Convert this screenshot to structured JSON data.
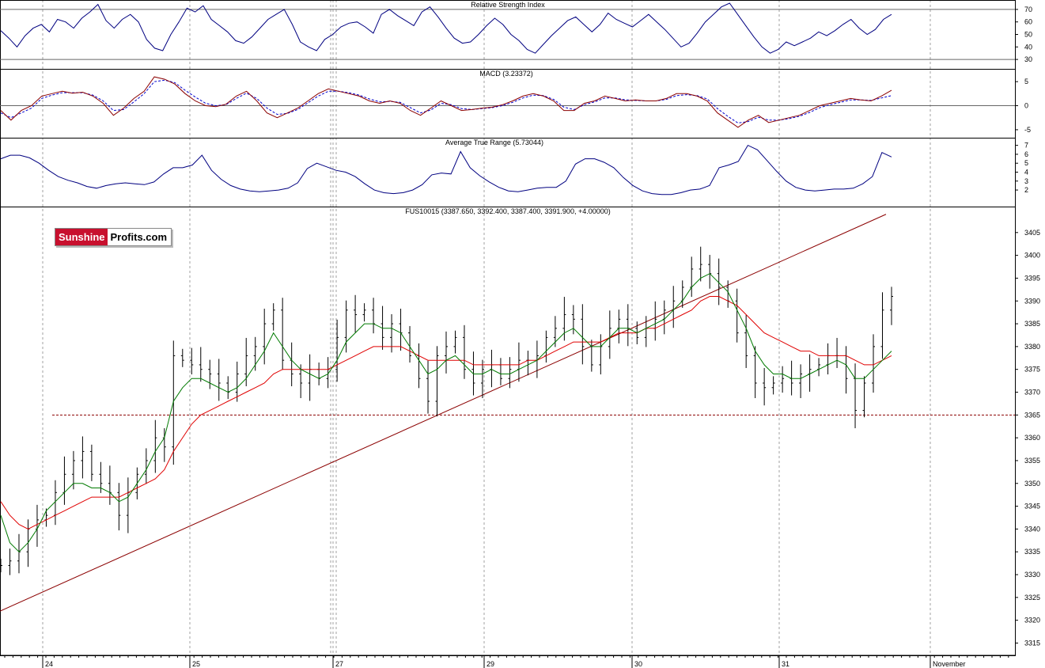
{
  "brand": {
    "part1": "Sunshine",
    "part2": "Profits.com"
  },
  "colors": {
    "rsi": "#000080",
    "macd": "#8b0000",
    "macd_signal": "#0000cd",
    "atr": "#000080",
    "bars": "#000000",
    "ma_fast": "#007a00",
    "ma_slow": "#e00000",
    "trendline": "#8b0000",
    "support": "#8b0000",
    "grid": "#a0a0a0"
  },
  "chart_data": [
    {
      "type": "line",
      "title": "Relative Strength Index",
      "ylim": [
        25,
        75
      ],
      "yticks": [
        30,
        40,
        50,
        60,
        70
      ],
      "reference_levels": [
        30,
        70
      ],
      "series": [
        {
          "values": [
            53,
            47,
            40,
            49,
            55,
            58,
            52,
            62,
            60,
            55,
            63,
            68,
            74,
            61,
            55,
            62,
            66,
            60,
            46,
            39,
            37,
            50,
            60,
            71,
            68,
            73,
            62,
            57,
            52,
            45,
            43,
            48,
            55,
            62,
            66,
            70,
            58,
            44,
            40,
            37,
            46,
            50,
            56,
            59,
            60,
            56,
            51,
            66,
            70,
            65,
            61,
            57,
            68,
            72,
            64,
            55,
            47,
            43,
            44,
            50,
            57,
            63,
            58,
            50,
            45,
            38,
            35,
            42,
            49,
            55,
            61,
            64,
            58,
            52,
            58,
            67,
            62,
            59,
            56,
            61,
            66,
            60,
            54,
            47,
            40,
            43,
            51,
            60,
            66,
            72,
            75,
            66,
            57,
            48,
            40,
            35,
            38,
            44,
            41,
            44,
            47,
            52,
            49,
            53,
            58,
            62,
            55,
            50,
            54,
            62,
            66
          ]
        }
      ]
    },
    {
      "type": "line",
      "title": "MACD (3.23372)",
      "ylim": [
        -6,
        7
      ],
      "yticks": [
        5,
        0,
        -5
      ],
      "series": [
        {
          "values": [
            -1,
            -3,
            -1,
            0,
            2,
            2.5,
            3,
            2.6,
            2.8,
            2,
            0.5,
            -2,
            -0.5,
            1.5,
            3,
            6,
            5.5,
            4.5,
            2.5,
            1,
            0,
            -0.2,
            0.3,
            2,
            3,
            1,
            -1.5,
            -2.5,
            -1.5,
            -0.5,
            1,
            2.5,
            3.5,
            3,
            2.5,
            2,
            1,
            0.5,
            1,
            0.5,
            -1,
            -2,
            -0.5,
            1,
            0,
            -1,
            -0.8,
            -0.5,
            -0.3,
            0.2,
            1,
            2,
            2.5,
            2,
            1,
            -1,
            -1,
            0.5,
            1,
            2,
            1.5,
            1,
            1.2,
            1,
            1,
            1.5,
            2.5,
            2.5,
            2,
            1,
            -1.5,
            -3,
            -4.5,
            -3,
            -2,
            -3.5,
            -3,
            -2.5,
            -2,
            -1,
            0,
            0.5,
            1,
            1.5,
            1.2,
            1,
            2,
            3.2
          ]
        },
        {
          "values": [
            -1.5,
            -2.5,
            -1.5,
            -0.5,
            1.5,
            2.2,
            2.7,
            2.7,
            2.7,
            2.2,
            1,
            -1,
            -0.8,
            0.8,
            2.5,
            5,
            5.3,
            4.8,
            3.2,
            1.8,
            0.5,
            0,
            0.2,
            1.5,
            2.6,
            1.5,
            -0.5,
            -1.8,
            -1.6,
            -0.8,
            0.6,
            2,
            3,
            3,
            2.7,
            2.2,
            1.4,
            0.8,
            0.9,
            0.7,
            -0.4,
            -1.5,
            -0.9,
            0.5,
            0.2,
            -0.6,
            -0.8,
            -0.6,
            -0.4,
            0,
            0.7,
            1.6,
            2.2,
            2.1,
            1.3,
            -0.3,
            -0.8,
            0.2,
            0.8,
            1.6,
            1.6,
            1.2,
            1.1,
            1,
            1,
            1.3,
            2.1,
            2.3,
            2.1,
            1.4,
            -0.6,
            -2.2,
            -3.6,
            -3.3,
            -2.4,
            -3,
            -3,
            -2.7,
            -2.2,
            -1.4,
            -0.4,
            0.2,
            0.7,
            1.2,
            1.2,
            1.1,
            1.6,
            2.1
          ]
        }
      ]
    },
    {
      "type": "line",
      "title": "Average True Range (5.73044)",
      "ylim": [
        0.5,
        7.5
      ],
      "yticks": [
        2,
        3,
        4,
        5,
        6,
        7
      ],
      "series": [
        {
          "values": [
            5.5,
            5.9,
            5.9,
            5.6,
            5,
            4.2,
            3.5,
            3.1,
            2.8,
            2.4,
            2.2,
            2.5,
            2.7,
            2.8,
            2.7,
            2.6,
            2.9,
            3.8,
            4.5,
            4.5,
            4.8,
            5.9,
            4.2,
            3.2,
            2.5,
            2.1,
            1.9,
            1.8,
            1.9,
            2,
            2.2,
            2.8,
            4.4,
            5,
            4.6,
            4.2,
            4,
            3.5,
            2.7,
            2,
            1.7,
            1.6,
            1.7,
            2,
            2.6,
            3.7,
            3.9,
            3.8,
            6.3,
            4.5,
            3.6,
            2.9,
            2.3,
            1.9,
            1.8,
            2,
            2.2,
            2.3,
            2.3,
            3,
            4.9,
            5.5,
            5.5,
            5.1,
            4.5,
            3.4,
            2.5,
            1.9,
            1.6,
            1.5,
            1.5,
            1.7,
            2,
            2.1,
            2.5,
            4.5,
            4.8,
            5.2,
            7,
            6.5,
            5.3,
            4.1,
            3,
            2.3,
            2,
            1.9,
            2,
            2.1,
            2.1,
            2.2,
            2.7,
            3.5,
            6.2,
            5.7
          ]
        }
      ]
    },
    {
      "type": "line",
      "title": "FUS10015 (3387.650, 3392.400, 3387.400, 3391.900, +4.00000)",
      "ylim": [
        3313,
        3410
      ],
      "yticks": [
        3315,
        3320,
        3325,
        3330,
        3335,
        3340,
        3345,
        3350,
        3355,
        3360,
        3365,
        3370,
        3375,
        3380,
        3385,
        3390,
        3395,
        3400,
        3405
      ],
      "x_tick_labels": [
        "24",
        "25",
        "27",
        "29",
        "30",
        "31",
        "November"
      ],
      "series": [
        {
          "values": [
            3332,
            3333,
            3335,
            3340,
            3342,
            3343,
            3348,
            3352,
            3355,
            3357,
            3352,
            3350,
            3348,
            3343,
            3348,
            3352,
            3355,
            3360,
            3358,
            3378,
            3377,
            3376,
            3375,
            3374,
            3372,
            3370,
            3374,
            3378,
            3380,
            3385,
            3388,
            3377,
            3374,
            3372,
            3375,
            3373,
            3375,
            3382,
            3388,
            3387,
            3388,
            3385,
            3382,
            3385,
            3383,
            3378,
            3373,
            3368,
            3378,
            3380,
            3382,
            3375,
            3372,
            3375,
            3376,
            3373,
            3375,
            3377,
            3377,
            3378,
            3382,
            3384,
            3387,
            3386,
            3380,
            3376,
            3380,
            3384,
            3386,
            3384,
            3382,
            3384,
            3386,
            3388,
            3390,
            3393,
            3397,
            3398,
            3396,
            3393,
            3390,
            3383,
            3378,
            3372,
            3371,
            3372,
            3373,
            3372,
            3374,
            3375,
            3376,
            3378,
            3378,
            3373,
            3366,
            3372,
            3380,
            3388,
            3391
          ]
        },
        {
          "values": [
            3343,
            3337,
            3335,
            3337,
            3340,
            3344,
            3346,
            3348,
            3350,
            3350,
            3349,
            3349,
            3348,
            3346,
            3347,
            3350,
            3353,
            3357,
            3360,
            3368,
            3371,
            3373,
            3373,
            3372,
            3371,
            3370,
            3371,
            3373,
            3376,
            3379,
            3383,
            3380,
            3377,
            3375,
            3374,
            3373,
            3374,
            3377,
            3381,
            3383,
            3385,
            3385,
            3384,
            3384,
            3383,
            3380,
            3377,
            3374,
            3375,
            3377,
            3378,
            3376,
            3374,
            3374,
            3375,
            3374,
            3374,
            3375,
            3376,
            3377,
            3379,
            3381,
            3383,
            3384,
            3382,
            3380,
            3380,
            3382,
            3384,
            3384,
            3383,
            3384,
            3385,
            3386,
            3388,
            3390,
            3393,
            3395,
            3396,
            3394,
            3392,
            3388,
            3384,
            3379,
            3376,
            3374,
            3374,
            3373,
            3373,
            3374,
            3375,
            3376,
            3377,
            3376,
            3373,
            3373,
            3375,
            3377,
            3379
          ]
        },
        {
          "values": [
            3346,
            3343,
            3341,
            3340,
            3341,
            3342,
            3343,
            3344,
            3345,
            3346,
            3347,
            3347,
            3347,
            3347,
            3348,
            3349,
            3350,
            3351,
            3353,
            3357,
            3360,
            3363,
            3365,
            3366,
            3367,
            3368,
            3369,
            3370,
            3371,
            3372,
            3374,
            3375,
            3375,
            3375,
            3375,
            3375,
            3375,
            3376,
            3377,
            3378,
            3379,
            3380,
            3380,
            3380,
            3380,
            3379,
            3378,
            3377,
            3377,
            3377,
            3377,
            3377,
            3376,
            3376,
            3376,
            3376,
            3376,
            3376,
            3377,
            3377,
            3378,
            3379,
            3380,
            3381,
            3381,
            3381,
            3381,
            3382,
            3383,
            3383,
            3383,
            3384,
            3384,
            3385,
            3386,
            3387,
            3388,
            3390,
            3391,
            3391,
            3390,
            3389,
            3387,
            3385,
            3383,
            3382,
            3381,
            3380,
            3379,
            3379,
            3378,
            3378,
            3378,
            3378,
            3377,
            3376,
            3376,
            3377,
            3378
          ]
        }
      ],
      "annotations": {
        "support_level": 3365,
        "trendline_from": 3322,
        "trendline_to": 3409
      }
    }
  ]
}
